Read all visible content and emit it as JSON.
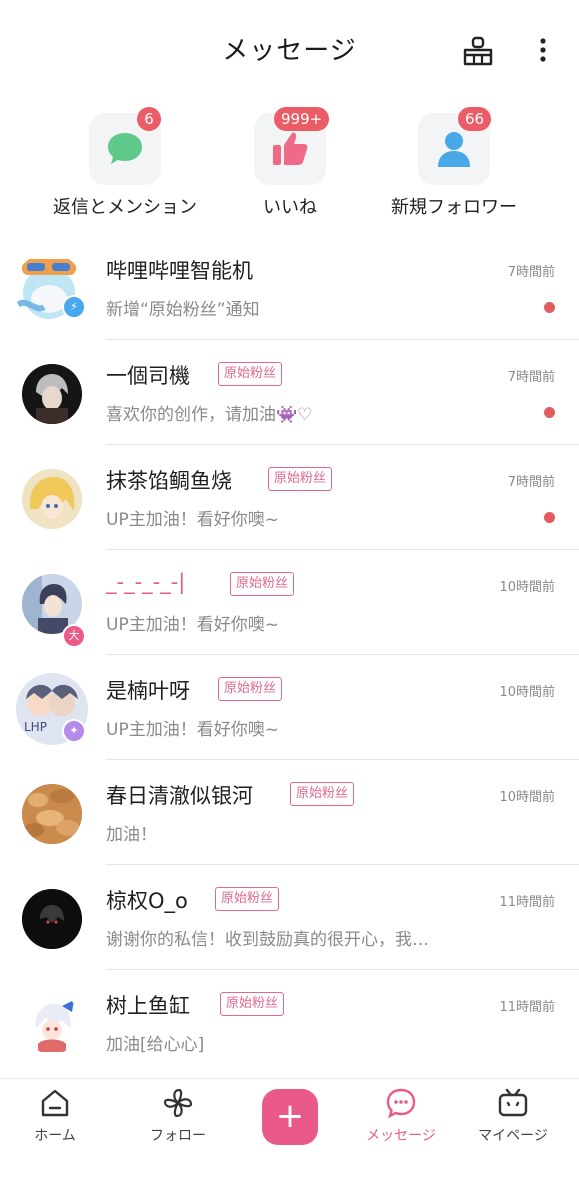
{
  "header": {
    "title": "メッセージ",
    "clean_icon": "broom-icon",
    "more_icon": "more-vertical-icon"
  },
  "categories": [
    {
      "label": "返信とメンション",
      "badge": "6",
      "icon": "chat-bubble-icon",
      "color": "#5fc98a"
    },
    {
      "label": "いいね",
      "badge": "999+",
      "icon": "thumbs-up-icon",
      "color": "#ee6a86"
    },
    {
      "label": "新規フォロワー",
      "badge": "66",
      "icon": "user-icon",
      "color": "#48a8e8"
    }
  ],
  "messages": [
    {
      "name": "哔哩哔哩智能机",
      "tag": "",
      "preview": "新增“原始粉丝”通知",
      "time": "7時間前",
      "unread": true
    },
    {
      "name": "一個司機",
      "tag": "原始粉丝",
      "preview": "喜欢你的创作，请加油👾♡",
      "time": "7時間前",
      "unread": true
    },
    {
      "name": "抹茶馅鲷鱼烧",
      "tag": "原始粉丝",
      "preview": "UP主加油！看好你噢~",
      "time": "7時間前",
      "unread": true
    },
    {
      "name": "_-_-_-_-|",
      "tag": "原始粉丝",
      "preview": "UP主加油！看好你噢~",
      "time": "10時間前",
      "unread": false
    },
    {
      "name": "是楠叶呀",
      "tag": "原始粉丝",
      "preview": "UP主加油！看好你噢~",
      "time": "10時間前",
      "unread": false
    },
    {
      "name": "春日清澈似银河",
      "tag": "原始粉丝",
      "preview": "加油！",
      "time": "10時間前",
      "unread": false
    },
    {
      "name": "椋权O_o",
      "tag": "原始粉丝",
      "preview": "谢谢你的私信！收到鼓励真的很开心，我…",
      "time": "11時間前",
      "unread": false
    },
    {
      "name": "树上鱼缸",
      "tag": "原始粉丝",
      "preview": "加油[给心心]",
      "time": "11時間前",
      "unread": false
    }
  ],
  "nav": {
    "home": "ホーム",
    "follow": "フォロー",
    "plus": "+",
    "messages": "メッセージ",
    "mypage": "マイページ"
  },
  "colors": {
    "accent": "#e95a8a",
    "badge": "#ea5c66",
    "tag": "#e06a8d",
    "unread_dot": "#e25c5c"
  }
}
